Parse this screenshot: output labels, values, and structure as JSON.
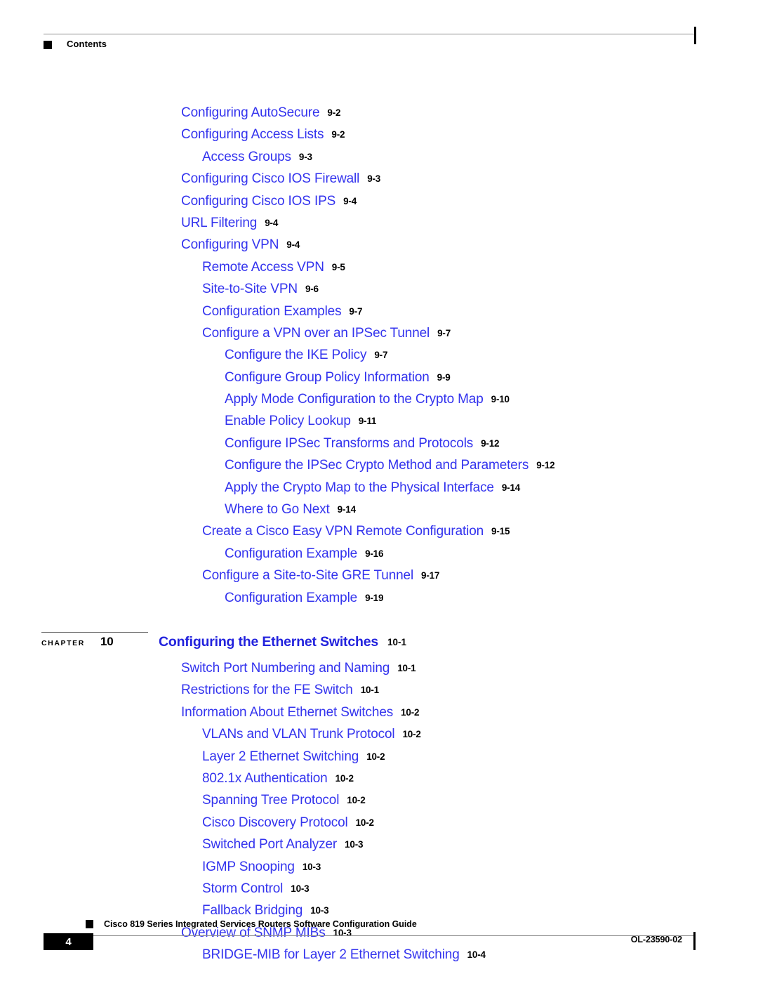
{
  "header": {
    "label": "Contents"
  },
  "toc": {
    "entries": [
      {
        "level": 1,
        "title": "Configuring AutoSecure",
        "page": "9-2"
      },
      {
        "level": 1,
        "title": "Configuring Access Lists",
        "page": "9-2"
      },
      {
        "level": 2,
        "title": "Access Groups",
        "page": "9-3"
      },
      {
        "level": 1,
        "title": "Configuring Cisco IOS Firewall",
        "page": "9-3"
      },
      {
        "level": 1,
        "title": "Configuring Cisco IOS IPS",
        "page": "9-4"
      },
      {
        "level": 1,
        "title": "URL Filtering",
        "page": "9-4"
      },
      {
        "level": 1,
        "title": "Configuring VPN",
        "page": "9-4"
      },
      {
        "level": 2,
        "title": "Remote Access VPN",
        "page": "9-5"
      },
      {
        "level": 2,
        "title": "Site-to-Site VPN",
        "page": "9-6"
      },
      {
        "level": 2,
        "title": "Configuration Examples",
        "page": "9-7"
      },
      {
        "level": 2,
        "title": "Configure a VPN over an IPSec Tunnel",
        "page": "9-7"
      },
      {
        "level": 3,
        "title": "Configure the IKE Policy",
        "page": "9-7"
      },
      {
        "level": 3,
        "title": "Configure Group Policy Information",
        "page": "9-9"
      },
      {
        "level": 3,
        "title": "Apply Mode Configuration to the Crypto Map",
        "page": "9-10"
      },
      {
        "level": 3,
        "title": "Enable Policy Lookup",
        "page": "9-11"
      },
      {
        "level": 3,
        "title": "Configure IPSec Transforms and Protocols",
        "page": "9-12"
      },
      {
        "level": 3,
        "title": "Configure the IPSec Crypto Method and Parameters",
        "page": "9-12"
      },
      {
        "level": 3,
        "title": "Apply the Crypto Map to the Physical Interface",
        "page": "9-14"
      },
      {
        "level": 3,
        "title": "Where to Go Next",
        "page": "9-14"
      },
      {
        "level": 2,
        "title": "Create a Cisco Easy VPN Remote Configuration",
        "page": "9-15"
      },
      {
        "level": 3,
        "title": "Configuration Example",
        "page": "9-16"
      },
      {
        "level": 2,
        "title": "Configure a Site-to-Site GRE Tunnel",
        "page": "9-17"
      },
      {
        "level": 3,
        "title": "Configuration Example",
        "page": "9-19"
      }
    ]
  },
  "chapter": {
    "word": "Chapter",
    "number": "10",
    "title": "Configuring the Ethernet Switches",
    "page": "10-1"
  },
  "toc2": {
    "entries": [
      {
        "level": 1,
        "title": "Switch Port Numbering and Naming",
        "page": "10-1"
      },
      {
        "level": 1,
        "title": "Restrictions for the FE Switch",
        "page": "10-1"
      },
      {
        "level": 1,
        "title": "Information About Ethernet Switches",
        "page": "10-2"
      },
      {
        "level": 2,
        "title": "VLANs and VLAN Trunk Protocol",
        "page": "10-2"
      },
      {
        "level": 2,
        "title": "Layer 2 Ethernet Switching",
        "page": "10-2"
      },
      {
        "level": 2,
        "title": "802.1x Authentication",
        "page": "10-2"
      },
      {
        "level": 2,
        "title": "Spanning Tree Protocol",
        "page": "10-2"
      },
      {
        "level": 2,
        "title": "Cisco Discovery Protocol",
        "page": "10-2"
      },
      {
        "level": 2,
        "title": "Switched Port Analyzer",
        "page": "10-3"
      },
      {
        "level": 2,
        "title": "IGMP Snooping",
        "page": "10-3"
      },
      {
        "level": 2,
        "title": "Storm Control",
        "page": "10-3"
      },
      {
        "level": 2,
        "title": "Fallback Bridging",
        "page": "10-3"
      },
      {
        "level": 1,
        "title": "Overview of SNMP MIBs",
        "page": "10-3"
      },
      {
        "level": 2,
        "title": "BRIDGE-MIB for Layer 2 Ethernet Switching",
        "page": "10-4"
      }
    ]
  },
  "footer": {
    "page_number": "4",
    "document_title": "Cisco 819 Series Integrated Services Routers Software Configuration Guide",
    "doc_id": "OL-23590-02"
  },
  "colors": {
    "link_blue": "#3333ee",
    "chapter_blue": "#2222dd",
    "rule_gray": "#8f8f8f",
    "text_black": "#000000"
  }
}
